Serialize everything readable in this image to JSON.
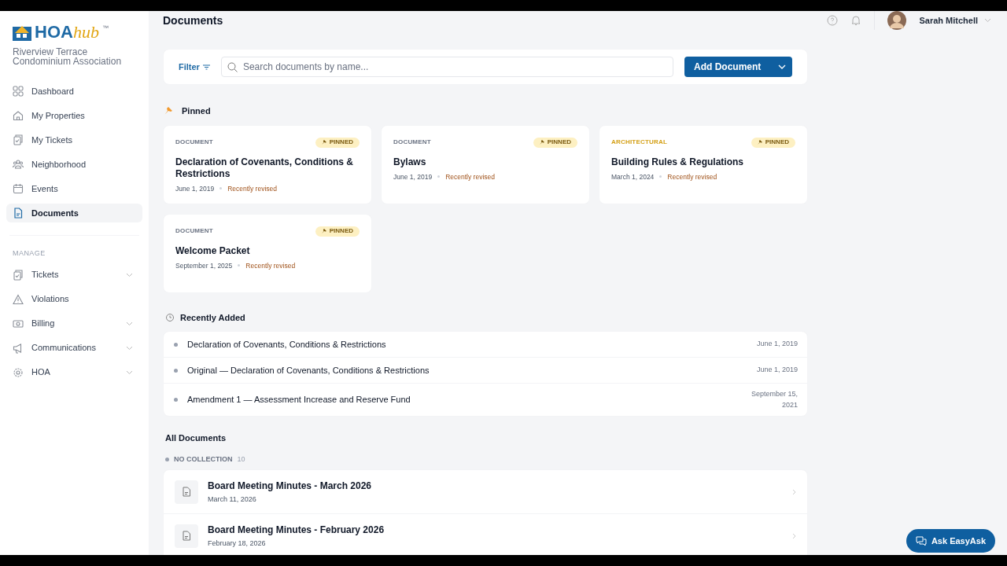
{
  "logo": {
    "word": "HOA",
    "script": "hub",
    "mark": "™"
  },
  "association": "Riverview Terrace Condominium Association",
  "nav": [
    {
      "label": "Dashboard",
      "kind": "grid",
      "selected": false
    },
    {
      "label": "My Properties",
      "kind": "home",
      "selected": false
    },
    {
      "label": "My Tickets",
      "kind": "ticket",
      "selected": false
    },
    {
      "label": "Neighborhood",
      "kind": "people",
      "selected": false
    },
    {
      "label": "Events",
      "kind": "calendar",
      "selected": false
    },
    {
      "label": "Documents",
      "kind": "doc",
      "selected": true
    }
  ],
  "manage": {
    "heading": "MANAGE",
    "items": [
      {
        "label": "Tickets",
        "kind": "ticket",
        "expandable": true
      },
      {
        "label": "Violations",
        "kind": "warning",
        "expandable": false
      },
      {
        "label": "Billing",
        "kind": "money",
        "expandable": true
      },
      {
        "label": "Communications",
        "kind": "megaphone",
        "expandable": true
      },
      {
        "label": "HOA",
        "kind": "gear",
        "expandable": true
      }
    ]
  },
  "header": {
    "title": "Documents",
    "user": "Sarah Mitchell"
  },
  "toolbar": {
    "filter": "Filter",
    "search_placeholder": "Search documents by name...",
    "add_button": "Add Document"
  },
  "pinned": {
    "heading": "Pinned",
    "cards": [
      {
        "category": "DOCUMENT",
        "kind": "document",
        "badge": "PINNED",
        "title": "Declaration of Covenants, Conditions & Restrictions",
        "date": "June 1, 2019",
        "status": "Recently revised"
      },
      {
        "category": "DOCUMENT",
        "kind": "document",
        "badge": "PINNED",
        "title": "Bylaws",
        "date": "June 1, 2019",
        "status": "Recently revised"
      },
      {
        "category": "ARCHITECTURAL",
        "kind": "architectural",
        "badge": "PINNED",
        "title": "Building Rules & Regulations",
        "date": "March 1, 2024",
        "status": "Recently revised"
      },
      {
        "category": "DOCUMENT",
        "kind": "document",
        "badge": "PINNED",
        "title": "Welcome Packet",
        "date": "September 1, 2025",
        "status": "Recently revised"
      }
    ]
  },
  "recent": {
    "heading": "Recently Added",
    "rows": [
      {
        "title": "Declaration of Covenants, Conditions & Restrictions",
        "date": "June 1, 2019"
      },
      {
        "title": "Original — Declaration of Covenants, Conditions & Restrictions",
        "date": "June 1, 2019"
      },
      {
        "title": "Amendment 1 — Assessment Increase and Reserve Fund",
        "date": "September 15, 2021"
      }
    ]
  },
  "all": {
    "heading": "All Documents",
    "collection": "NO COLLECTION",
    "count": "10",
    "rows": [
      {
        "title": "Board Meeting Minutes - March 2026",
        "date": "March 11, 2026"
      },
      {
        "title": "Board Meeting Minutes - February 2026",
        "date": "February 18, 2026"
      }
    ]
  },
  "chat_button": "Ask EasyAsk"
}
